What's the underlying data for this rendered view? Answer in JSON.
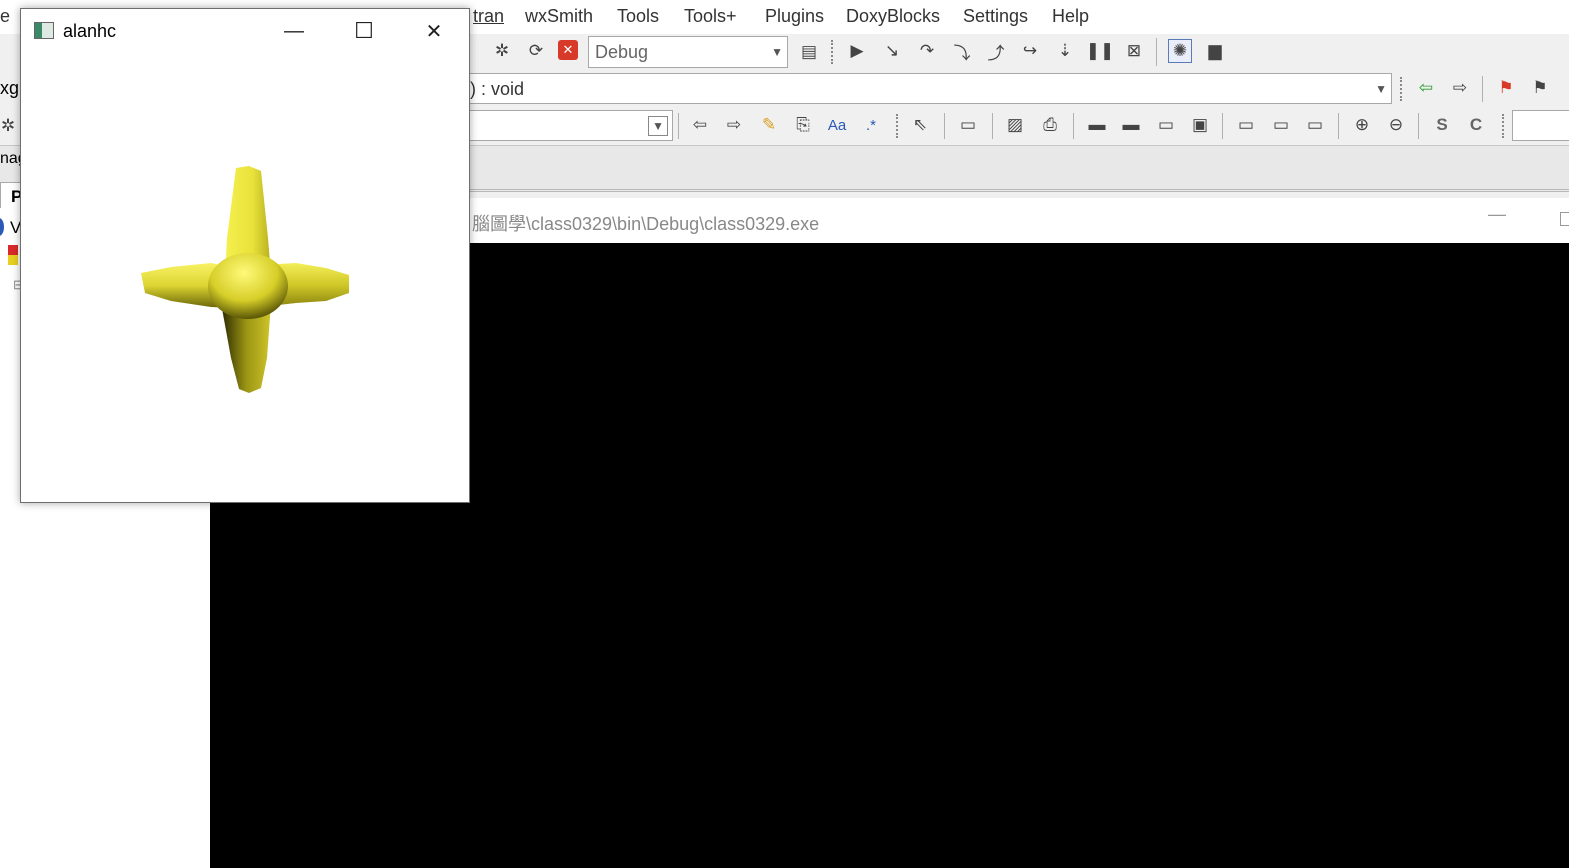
{
  "ide": {
    "menu": [
      "e",
      "tran",
      "wxSmith",
      "Tools",
      "Tools+",
      "Plugins",
      "DoxyBlocks",
      "Settings",
      "Help"
    ],
    "build_target": "Debug",
    "scope_signature": ") : void",
    "left_fragments": {
      "row1": "xgl",
      "row3": "nag",
      "tab": "P",
      "item": "V"
    }
  },
  "console": {
    "title": "腦圖學\\class0329\\bin\\Debug\\class0329.exe",
    "minimize": "—"
  },
  "glut_window": {
    "title": "alanhc",
    "minimize": "—",
    "maximize": "☐",
    "close": "✕",
    "shape_color": "#e6e02a"
  },
  "icons": {
    "toolbar1": [
      "abort-icon",
      "build-settings-icon",
      "run-icon",
      "debug-next-icon",
      "step-into-icon",
      "step-out-icon",
      "next-instruction-icon",
      "step-instruction-icon",
      "run-to-cursor-icon",
      "pause-icon",
      "stop-icon",
      "window-icon"
    ],
    "toolbar3": [
      "back-icon",
      "forward-icon",
      "highlight-icon",
      "replace-icon",
      "match-case-icon",
      "regex-icon"
    ]
  }
}
